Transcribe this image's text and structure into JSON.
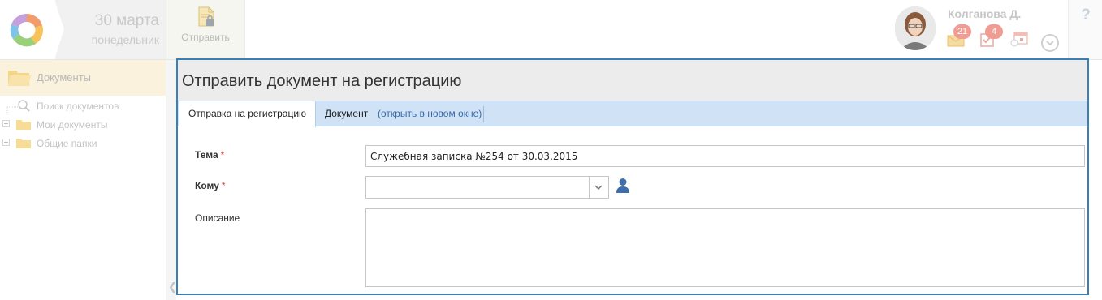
{
  "header": {
    "date_main": "30 марта",
    "date_sub": "понедельник",
    "send_label": "Отправить",
    "user_name": "Колганова Д.",
    "mail_count": "21",
    "tasks_count": "4",
    "help": "?"
  },
  "sidebar": {
    "title": "Документы",
    "items": [
      {
        "label": "Поиск документов",
        "icon": "search-icon"
      },
      {
        "label": "Мои документы",
        "icon": "folder-icon"
      },
      {
        "label": "Общие папки",
        "icon": "folder-icon"
      }
    ]
  },
  "dialog": {
    "title": "Отправить документ на регистрацию",
    "tabs": {
      "active": "Отправка на регистрацию",
      "document": "Документ",
      "open_link": "(открыть в новом окне)"
    },
    "fields": {
      "subject_label": "Тема",
      "subject_value": "Служебная записка №254 от 30.03.2015",
      "to_label": "Кому",
      "to_value": "",
      "description_label": "Описание",
      "description_value": "",
      "required_mark": "*"
    }
  },
  "colors": {
    "accent_border": "#3a7fb6",
    "tabbar_bg": "#cfe2f6",
    "required": "#d9342b",
    "link": "#3a6aa6"
  }
}
